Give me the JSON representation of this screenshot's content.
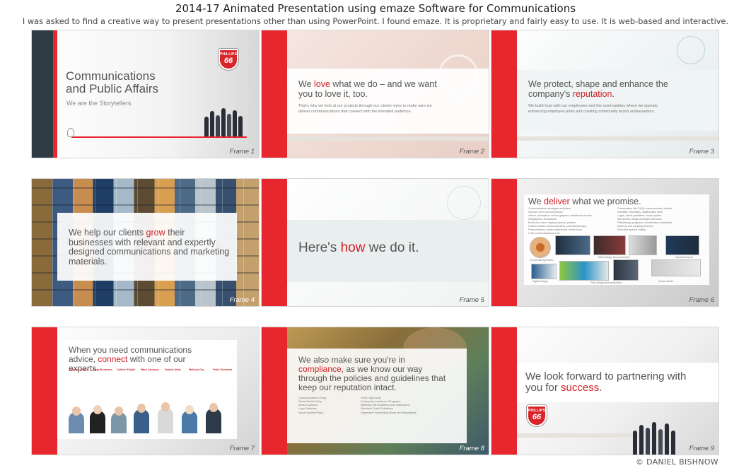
{
  "page": {
    "title": "2014-17 Animated Presentation using emaze Software for Communications",
    "subtitle": "I was asked to find a creative way to present presentations other than using PowerPoint. I found emaze. It is proprietary and fairly easy to use. It is web-based and interactive.",
    "copyright": "© DANIEL BISHNOW"
  },
  "colors": {
    "accent_red": "#e8262d",
    "text_gray": "#555555",
    "dark_panel": "#2f3b44"
  },
  "frames": [
    {
      "label": "Frame 1",
      "heading_line1": "Communications",
      "heading_line2": "and Public Affairs",
      "tagline": "We are the Storytellers",
      "logo_top": "PHILLIPS",
      "logo_number": "66"
    },
    {
      "label": "Frame 2",
      "heading_a": "We ",
      "heading_em": "love",
      "heading_b": " what we do – and we want you to love it, too.",
      "body": "That's why we look at our projects through our clients' eyes to make sure we deliver communications that connect with the intended audience."
    },
    {
      "label": "Frame 3",
      "heading_a": "We protect, shape and enhance the company's ",
      "heading_em": "reputation",
      "heading_b": ".",
      "body": "We build trust with our employees and the communities where we operate, enhancing employee pride and creating community brand ambassadors."
    },
    {
      "label": "Frame 4",
      "heading_a": "We help our clients ",
      "heading_em": "grow",
      "heading_b": " their businesses with relevant and expertly designed communications and marketing materials."
    },
    {
      "label": "Frame 5",
      "heading_a": "Here's ",
      "heading_em": "how",
      "heading_b": " we do it."
    },
    {
      "label": "Frame 6",
      "heading_a": "We ",
      "heading_em": "deliver",
      "heading_b": " what we promise.",
      "list_left": [
        "Communications strategies and plans.",
        "Special event communications.",
        "Videos, animations, motion graphics, whiteboard movies.",
        "Infographics, illustrations.",
        "Brochures, fliers, display banners, posters.",
        "Feature articles, announcements, promotional copy.",
        "Press releases, press conferences, media tours.",
        "Crisis communications tools."
      ],
      "list_right": [
        "Conversation kits, FAQs, communication toolkits.",
        "Websites, microsites, collaboration sites.",
        "Logos, brand guidelines, visual system.",
        "Self-service design templates and tools.",
        "Philanthropy programs, volunteerism, leadership.",
        "Museum and company archives.",
        "Executive speech writing."
      ],
      "captions": [
        "10 Life Saving Rules",
        "Video design and production",
        "Advertisements",
        "Digital design",
        "Print design and production",
        "Social media"
      ]
    },
    {
      "label": "Frame 7",
      "heading_a": "When you need communications advice, ",
      "heading_em": "connect",
      "heading_b": " with one of our experts.",
      "experts": [
        "Summer Austin",
        "Kristi Beshears",
        "Colleen Feigin",
        "Mark Johnson",
        "Dennis Nuss",
        "Melissa Ory",
        "Peter Schwartz"
      ]
    },
    {
      "label": "Frame 8",
      "heading_a": "We also make sure you're in ",
      "heading_em": "compliance",
      "heading_b": ", as we know our way through the policies and guidelines that keep our reputation intact.",
      "list_left": [
        "Communications Policy",
        "Social Media Policy",
        "Media Guidance",
        "Logo Guidance",
        "Visual System Policy"
      ],
      "list_right": [
        "GASC Approvals",
        "Community Investment Programs",
        "Matching Gift Guidelines and Instructions",
        "Volunteer Grant Guidelines",
        "Dependent Scholarship Rules and Regulations"
      ]
    },
    {
      "label": "Frame 9",
      "heading_a": "We look forward to partnering with you for ",
      "heading_em": "success",
      "heading_b": ".",
      "logo_top": "PHILLIPS",
      "logo_number": "66"
    }
  ]
}
